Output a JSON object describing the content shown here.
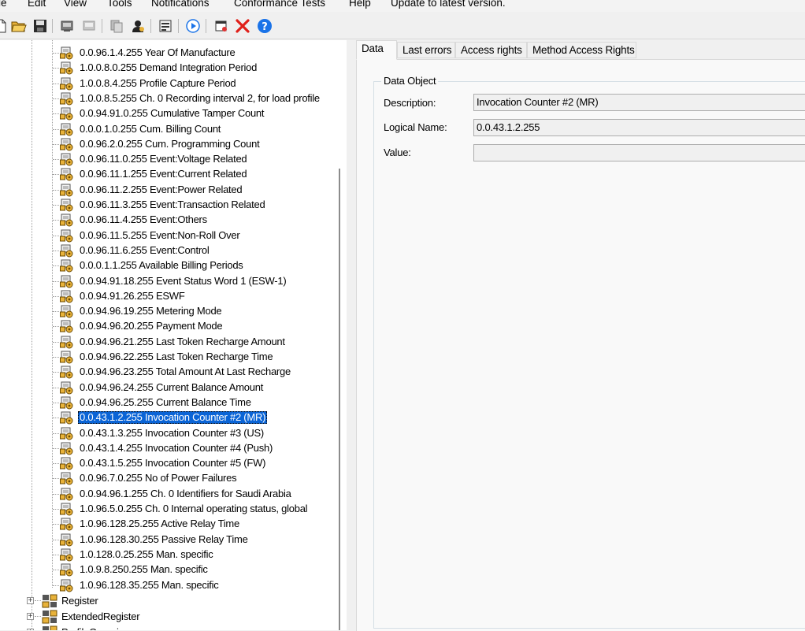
{
  "menu": [
    "le",
    "Edit",
    "View",
    "Tools",
    "Notifications",
    "Conformance Tests",
    "Help",
    "Update to latest version."
  ],
  "toolbar": {
    "icons": [
      "new-icon",
      "open-folder-icon",
      "save-icon",
      "read-icon",
      "write-icon",
      "copy-icon",
      "user-icon",
      "properties-icon",
      "run-icon",
      "settings-icon",
      "delete-icon",
      "help-icon"
    ],
    "colors": {
      "delete": "#e0201a",
      "help": "#1a73e8",
      "run": "#1a73e8"
    }
  },
  "tree": {
    "items": [
      "0.0.96.1.4.255 Year Of Manufacture",
      "1.0.0.8.0.255 Demand Integration Period",
      "1.0.0.8.4.255 Profile Capture Period",
      "1.0.0.8.5.255 Ch. 0 Recording interval 2, for load profile",
      "0.0.94.91.0.255 Cumulative Tamper Count",
      "0.0.0.1.0.255 Cum. Billing Count",
      "0.0.96.2.0.255 Cum. Programming Count",
      "0.0.96.11.0.255 Event:Voltage Related",
      "0.0.96.11.1.255 Event:Current Related",
      "0.0.96.11.2.255 Event:Power Related",
      "0.0.96.11.3.255 Event:Transaction Related",
      "0.0.96.11.4.255 Event:Others",
      "0.0.96.11.5.255 Event:Non-Roll Over",
      "0.0.96.11.6.255 Event:Control",
      "0.0.0.1.1.255 Available Billing Periods",
      "0.0.94.91.18.255 Event Status Word 1 (ESW-1)",
      "0.0.94.91.26.255 ESWF",
      "0.0.94.96.19.255 Metering Mode",
      "0.0.94.96.20.255 Payment Mode",
      "0.0.94.96.21.255 Last Token Recharge Amount",
      "0.0.94.96.22.255 Last Token Recharge Time",
      "0.0.94.96.23.255 Total Amount At Last Recharge",
      "0.0.94.96.24.255 Current Balance Amount",
      "0.0.94.96.25.255 Current Balance Time",
      "0.0.43.1.2.255 Invocation Counter #2 (MR)",
      "0.0.43.1.3.255 Invocation Counter #3 (US)",
      "0.0.43.1.4.255 Invocation Counter #4 (Push)",
      "0.0.43.1.5.255 Invocation Counter #5 (FW)",
      "0.0.96.7.0.255 No of Power Failures",
      "0.0.94.96.1.255 Ch. 0 Identifiers for Saudi Arabia",
      "1.0.96.5.0.255 Ch. 0 Internal operating status, global",
      "1.0.96.128.25.255 Active Relay Time",
      "1.0.96.128.30.255 Passive Relay Time",
      "1.0.128.0.25.255 Man. specific",
      "1.0.9.8.250.255 Man. specific",
      "1.0.96.128.35.255 Man. specific"
    ],
    "selected_index": 24,
    "categories": [
      "Register",
      "ExtendedRegister",
      "ProfileGeneric"
    ],
    "selection_color": "#0a64d6"
  },
  "tabs": [
    "Data",
    "Last errors",
    "Access rights",
    "Method Access Rights"
  ],
  "active_tab": "Data",
  "data_object": {
    "group_title": "Data Object",
    "description_label": "Description:",
    "description_value": "Invocation Counter #2 (MR)",
    "logical_name_label": "Logical Name:",
    "logical_name_value": "0.0.43.1.2.255",
    "value_label": "Value:",
    "value_value": ""
  }
}
